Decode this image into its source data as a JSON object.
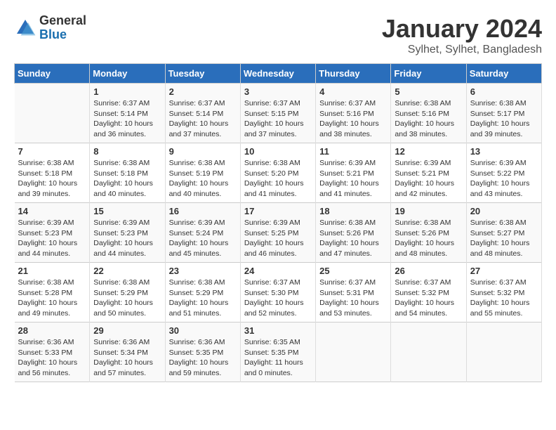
{
  "logo": {
    "line1": "General",
    "line2": "Blue"
  },
  "title": "January 2024",
  "subtitle": "Sylhet, Sylhet, Bangladesh",
  "days_of_week": [
    "Sunday",
    "Monday",
    "Tuesday",
    "Wednesday",
    "Thursday",
    "Friday",
    "Saturday"
  ],
  "weeks": [
    [
      {
        "num": "",
        "info": ""
      },
      {
        "num": "1",
        "info": "Sunrise: 6:37 AM\nSunset: 5:14 PM\nDaylight: 10 hours\nand 36 minutes."
      },
      {
        "num": "2",
        "info": "Sunrise: 6:37 AM\nSunset: 5:14 PM\nDaylight: 10 hours\nand 37 minutes."
      },
      {
        "num": "3",
        "info": "Sunrise: 6:37 AM\nSunset: 5:15 PM\nDaylight: 10 hours\nand 37 minutes."
      },
      {
        "num": "4",
        "info": "Sunrise: 6:37 AM\nSunset: 5:16 PM\nDaylight: 10 hours\nand 38 minutes."
      },
      {
        "num": "5",
        "info": "Sunrise: 6:38 AM\nSunset: 5:16 PM\nDaylight: 10 hours\nand 38 minutes."
      },
      {
        "num": "6",
        "info": "Sunrise: 6:38 AM\nSunset: 5:17 PM\nDaylight: 10 hours\nand 39 minutes."
      }
    ],
    [
      {
        "num": "7",
        "info": "Sunrise: 6:38 AM\nSunset: 5:18 PM\nDaylight: 10 hours\nand 39 minutes."
      },
      {
        "num": "8",
        "info": "Sunrise: 6:38 AM\nSunset: 5:18 PM\nDaylight: 10 hours\nand 40 minutes."
      },
      {
        "num": "9",
        "info": "Sunrise: 6:38 AM\nSunset: 5:19 PM\nDaylight: 10 hours\nand 40 minutes."
      },
      {
        "num": "10",
        "info": "Sunrise: 6:38 AM\nSunset: 5:20 PM\nDaylight: 10 hours\nand 41 minutes."
      },
      {
        "num": "11",
        "info": "Sunrise: 6:39 AM\nSunset: 5:21 PM\nDaylight: 10 hours\nand 41 minutes."
      },
      {
        "num": "12",
        "info": "Sunrise: 6:39 AM\nSunset: 5:21 PM\nDaylight: 10 hours\nand 42 minutes."
      },
      {
        "num": "13",
        "info": "Sunrise: 6:39 AM\nSunset: 5:22 PM\nDaylight: 10 hours\nand 43 minutes."
      }
    ],
    [
      {
        "num": "14",
        "info": "Sunrise: 6:39 AM\nSunset: 5:23 PM\nDaylight: 10 hours\nand 44 minutes."
      },
      {
        "num": "15",
        "info": "Sunrise: 6:39 AM\nSunset: 5:23 PM\nDaylight: 10 hours\nand 44 minutes."
      },
      {
        "num": "16",
        "info": "Sunrise: 6:39 AM\nSunset: 5:24 PM\nDaylight: 10 hours\nand 45 minutes."
      },
      {
        "num": "17",
        "info": "Sunrise: 6:39 AM\nSunset: 5:25 PM\nDaylight: 10 hours\nand 46 minutes."
      },
      {
        "num": "18",
        "info": "Sunrise: 6:38 AM\nSunset: 5:26 PM\nDaylight: 10 hours\nand 47 minutes."
      },
      {
        "num": "19",
        "info": "Sunrise: 6:38 AM\nSunset: 5:26 PM\nDaylight: 10 hours\nand 48 minutes."
      },
      {
        "num": "20",
        "info": "Sunrise: 6:38 AM\nSunset: 5:27 PM\nDaylight: 10 hours\nand 48 minutes."
      }
    ],
    [
      {
        "num": "21",
        "info": "Sunrise: 6:38 AM\nSunset: 5:28 PM\nDaylight: 10 hours\nand 49 minutes."
      },
      {
        "num": "22",
        "info": "Sunrise: 6:38 AM\nSunset: 5:29 PM\nDaylight: 10 hours\nand 50 minutes."
      },
      {
        "num": "23",
        "info": "Sunrise: 6:38 AM\nSunset: 5:29 PM\nDaylight: 10 hours\nand 51 minutes."
      },
      {
        "num": "24",
        "info": "Sunrise: 6:37 AM\nSunset: 5:30 PM\nDaylight: 10 hours\nand 52 minutes."
      },
      {
        "num": "25",
        "info": "Sunrise: 6:37 AM\nSunset: 5:31 PM\nDaylight: 10 hours\nand 53 minutes."
      },
      {
        "num": "26",
        "info": "Sunrise: 6:37 AM\nSunset: 5:32 PM\nDaylight: 10 hours\nand 54 minutes."
      },
      {
        "num": "27",
        "info": "Sunrise: 6:37 AM\nSunset: 5:32 PM\nDaylight: 10 hours\nand 55 minutes."
      }
    ],
    [
      {
        "num": "28",
        "info": "Sunrise: 6:36 AM\nSunset: 5:33 PM\nDaylight: 10 hours\nand 56 minutes."
      },
      {
        "num": "29",
        "info": "Sunrise: 6:36 AM\nSunset: 5:34 PM\nDaylight: 10 hours\nand 57 minutes."
      },
      {
        "num": "30",
        "info": "Sunrise: 6:36 AM\nSunset: 5:35 PM\nDaylight: 10 hours\nand 59 minutes."
      },
      {
        "num": "31",
        "info": "Sunrise: 6:35 AM\nSunset: 5:35 PM\nDaylight: 11 hours\nand 0 minutes."
      },
      {
        "num": "",
        "info": ""
      },
      {
        "num": "",
        "info": ""
      },
      {
        "num": "",
        "info": ""
      }
    ]
  ]
}
